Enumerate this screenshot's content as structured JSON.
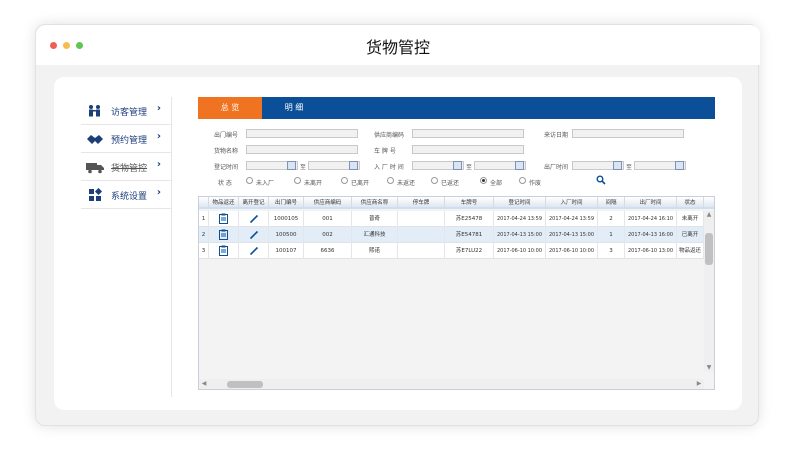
{
  "app": {
    "title": "货物管控"
  },
  "sidebar": {
    "items": [
      {
        "label": "访客管理",
        "icon": "visitors-icon",
        "arrow": "›"
      },
      {
        "label": "预约管理",
        "icon": "handshake-icon",
        "arrow": "›"
      },
      {
        "label": "货物管控",
        "icon": "truck-icon",
        "arrow": "›"
      },
      {
        "label": "系统设置",
        "icon": "settings-grid-icon",
        "arrow": "›"
      }
    ]
  },
  "tabs": [
    {
      "label": "总 览",
      "active": true
    },
    {
      "label": "明 细",
      "active": false
    }
  ],
  "form": {
    "row1": {
      "l1": "出门编号",
      "l2": "供应商编码",
      "l3": "来访日期"
    },
    "row2": {
      "l1": "货物名称",
      "l2": "车 牌 号"
    },
    "row3": {
      "l1": "登记时间",
      "l2": "入 厂 时 间",
      "l3": "出厂时间",
      "to": "至"
    },
    "status": {
      "label": "状 态",
      "options": [
        "未入厂",
        "未离开",
        "已离开",
        "未返还",
        "已返还",
        "全部",
        "作废"
      ],
      "selected": "全部"
    }
  },
  "grid": {
    "columns": [
      "物品返还",
      "离开登记",
      "出门编号",
      "供应商编码",
      "供应商名称",
      "停车牌",
      "车牌号",
      "登记时间",
      "入厂时间",
      "间隔",
      "出厂时间",
      "状态"
    ],
    "rows": [
      {
        "n": "1",
        "code": "1000105",
        "supplier_code": "001",
        "supplier_name": "普奇",
        "parking": "",
        "plate": "苏E25478",
        "reg_time": "2017-04-24 13:59",
        "in_time": "2017-04-24 13:59",
        "interval": "2",
        "out_time": "2017-04-24 16:10",
        "status": "未离开"
      },
      {
        "n": "2",
        "code": "100500",
        "supplier_code": "002",
        "supplier_name": "汇通科技",
        "parking": "",
        "plate": "苏E54781",
        "reg_time": "2017-04-13 15:00",
        "in_time": "2017-04-13 15:00",
        "interval": "1",
        "out_time": "2017-04-13 16:00",
        "status": "已离开"
      },
      {
        "n": "3",
        "code": "100107",
        "supplier_code": "6636",
        "supplier_name": "熙诺",
        "parking": "",
        "plate": "苏E7LU22",
        "reg_time": "2017-06-10 10:00",
        "in_time": "2017-06-10 10:00",
        "interval": "3",
        "out_time": "2017-06-10 13:00",
        "status": "物品返还"
      }
    ]
  },
  "colors": {
    "primary": "#0b4f99",
    "accent": "#f07322",
    "nav_text": "#1c3e7a"
  }
}
